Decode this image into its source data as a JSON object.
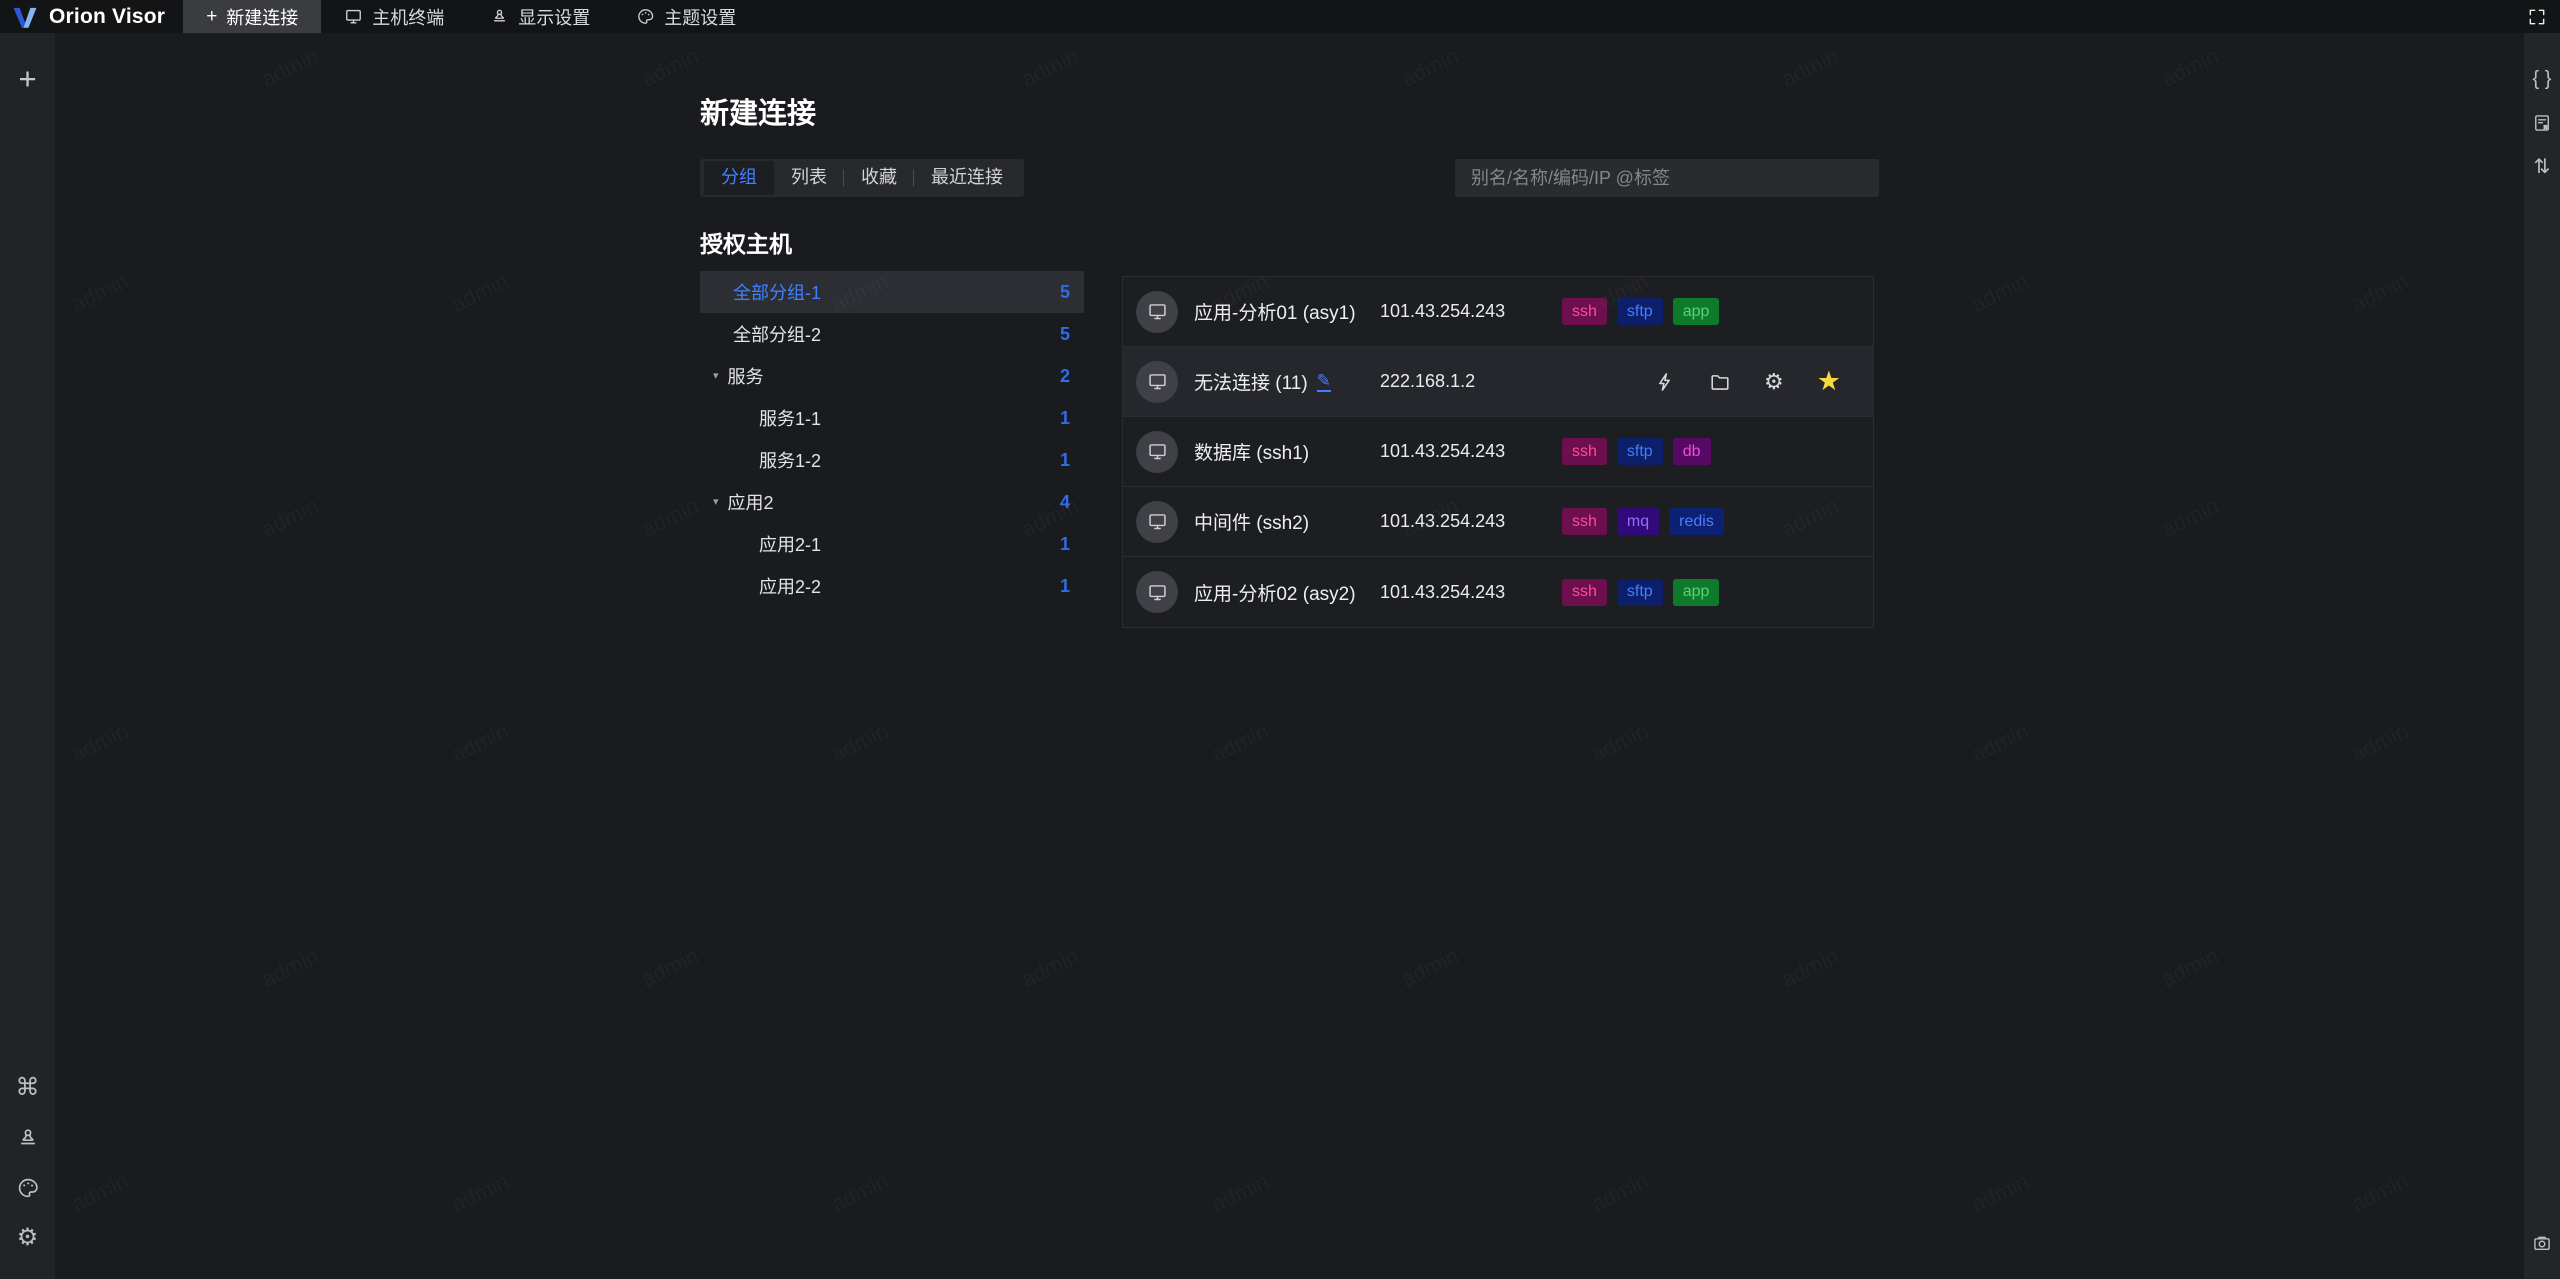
{
  "app": {
    "name": "Orion Visor"
  },
  "topbar": {
    "tabs": [
      {
        "label": "新建连接",
        "icon": "plus",
        "name": "new-connection",
        "active": true
      },
      {
        "label": "主机终端",
        "icon": "monitor",
        "name": "host-terminal",
        "active": false
      },
      {
        "label": "显示设置",
        "icon": "stamp",
        "name": "display-settings",
        "active": false
      },
      {
        "label": "主题设置",
        "icon": "palette",
        "name": "theme-settings",
        "active": false
      }
    ],
    "right_icons": [
      {
        "icon": "fullscreen",
        "name": "fullscreen"
      }
    ]
  },
  "left_rail": {
    "top_icons": [
      {
        "icon": "plus",
        "name": "add-connection"
      }
    ],
    "bottom_icons": [
      {
        "icon": "command",
        "name": "shortcuts"
      },
      {
        "icon": "stamp",
        "name": "display-settings"
      },
      {
        "icon": "palette",
        "name": "theme-settings"
      },
      {
        "icon": "gear",
        "name": "settings"
      }
    ]
  },
  "right_rail": {
    "top_icons": [
      {
        "icon": "braces",
        "name": "json-view"
      },
      {
        "icon": "doc-bookmark",
        "name": "bookmarks"
      },
      {
        "icon": "sort",
        "name": "sort"
      }
    ],
    "bottom_icons": [
      {
        "icon": "camera",
        "name": "screenshot"
      }
    ]
  },
  "page": {
    "title": "新建连接",
    "view_tabs": [
      {
        "label": "分组",
        "name": "group",
        "active": true
      },
      {
        "label": "列表",
        "name": "list",
        "active": false
      },
      {
        "label": "收藏",
        "name": "favorites",
        "active": false
      },
      {
        "label": "最近连接",
        "name": "recent",
        "active": false
      }
    ],
    "search": {
      "placeholder": "别名/名称/编码/IP @标签"
    },
    "tree": {
      "heading": "授权主机",
      "items": [
        {
          "label": "全部分组-1",
          "count": "5",
          "type": "group",
          "selected": true
        },
        {
          "label": "全部分组-2",
          "count": "5",
          "type": "group",
          "selected": false
        },
        {
          "label": "服务",
          "count": "2",
          "type": "parent",
          "selected": false
        },
        {
          "label": "服务1-1",
          "count": "1",
          "type": "child",
          "selected": false
        },
        {
          "label": "服务1-2",
          "count": "1",
          "type": "child",
          "selected": false
        },
        {
          "label": "应用2",
          "count": "4",
          "type": "parent",
          "selected": false
        },
        {
          "label": "应用2-1",
          "count": "1",
          "type": "child",
          "selected": false
        },
        {
          "label": "应用2-2",
          "count": "1",
          "type": "child",
          "selected": false
        }
      ]
    },
    "hosts": [
      {
        "name": "应用-分析01 (asy1)",
        "ip": "101.43.254.243",
        "tags": [
          "ssh",
          "sftp",
          "app"
        ],
        "edit": false,
        "hovered": false,
        "actions": []
      },
      {
        "name": "无法连接 (11)",
        "ip": "222.168.1.2",
        "tags": [],
        "edit": true,
        "hovered": true,
        "actions": [
          {
            "icon": "bolt",
            "name": "connect"
          },
          {
            "icon": "folder",
            "name": "sftp-files"
          },
          {
            "icon": "gear",
            "name": "host-settings"
          },
          {
            "icon": "star",
            "name": "favorite"
          }
        ]
      },
      {
        "name": "数据库 (ssh1)",
        "ip": "101.43.254.243",
        "tags": [
          "ssh",
          "sftp",
          "db"
        ],
        "edit": false,
        "hovered": false,
        "actions": []
      },
      {
        "name": "中间件 (ssh2)",
        "ip": "101.43.254.243",
        "tags": [
          "ssh",
          "mq",
          "redis"
        ],
        "edit": false,
        "hovered": false,
        "actions": []
      },
      {
        "name": "应用-分析02 (asy2)",
        "ip": "101.43.254.243",
        "tags": [
          "ssh",
          "sftp",
          "app"
        ],
        "edit": false,
        "hovered": false,
        "actions": []
      }
    ],
    "tag_colors": {
      "ssh": {
        "bg": "#6d0f4e",
        "fg": "#ff4d94"
      },
      "sftp": {
        "bg": "#0d1f6b",
        "fg": "#3e7eff"
      },
      "app": {
        "bg": "#0f7a2b",
        "fg": "#55d473"
      },
      "db": {
        "bg": "#570a64",
        "fg": "#e84fe0"
      },
      "mq": {
        "bg": "#300a7a",
        "fg": "#9a6bff"
      },
      "redis": {
        "bg": "#0c2173",
        "fg": "#4d7dff"
      }
    }
  },
  "watermark": {
    "text": "admin"
  },
  "colors": {
    "accent": "#4080ff",
    "count": "#2e6ce8",
    "star": "#f6d93e",
    "topbar_bg": "#131416",
    "content_bg": "#1a1b1e",
    "panel_bg": "#1d1e22",
    "logo_left": "#2c57d6",
    "logo_right": "#85b5f0"
  }
}
